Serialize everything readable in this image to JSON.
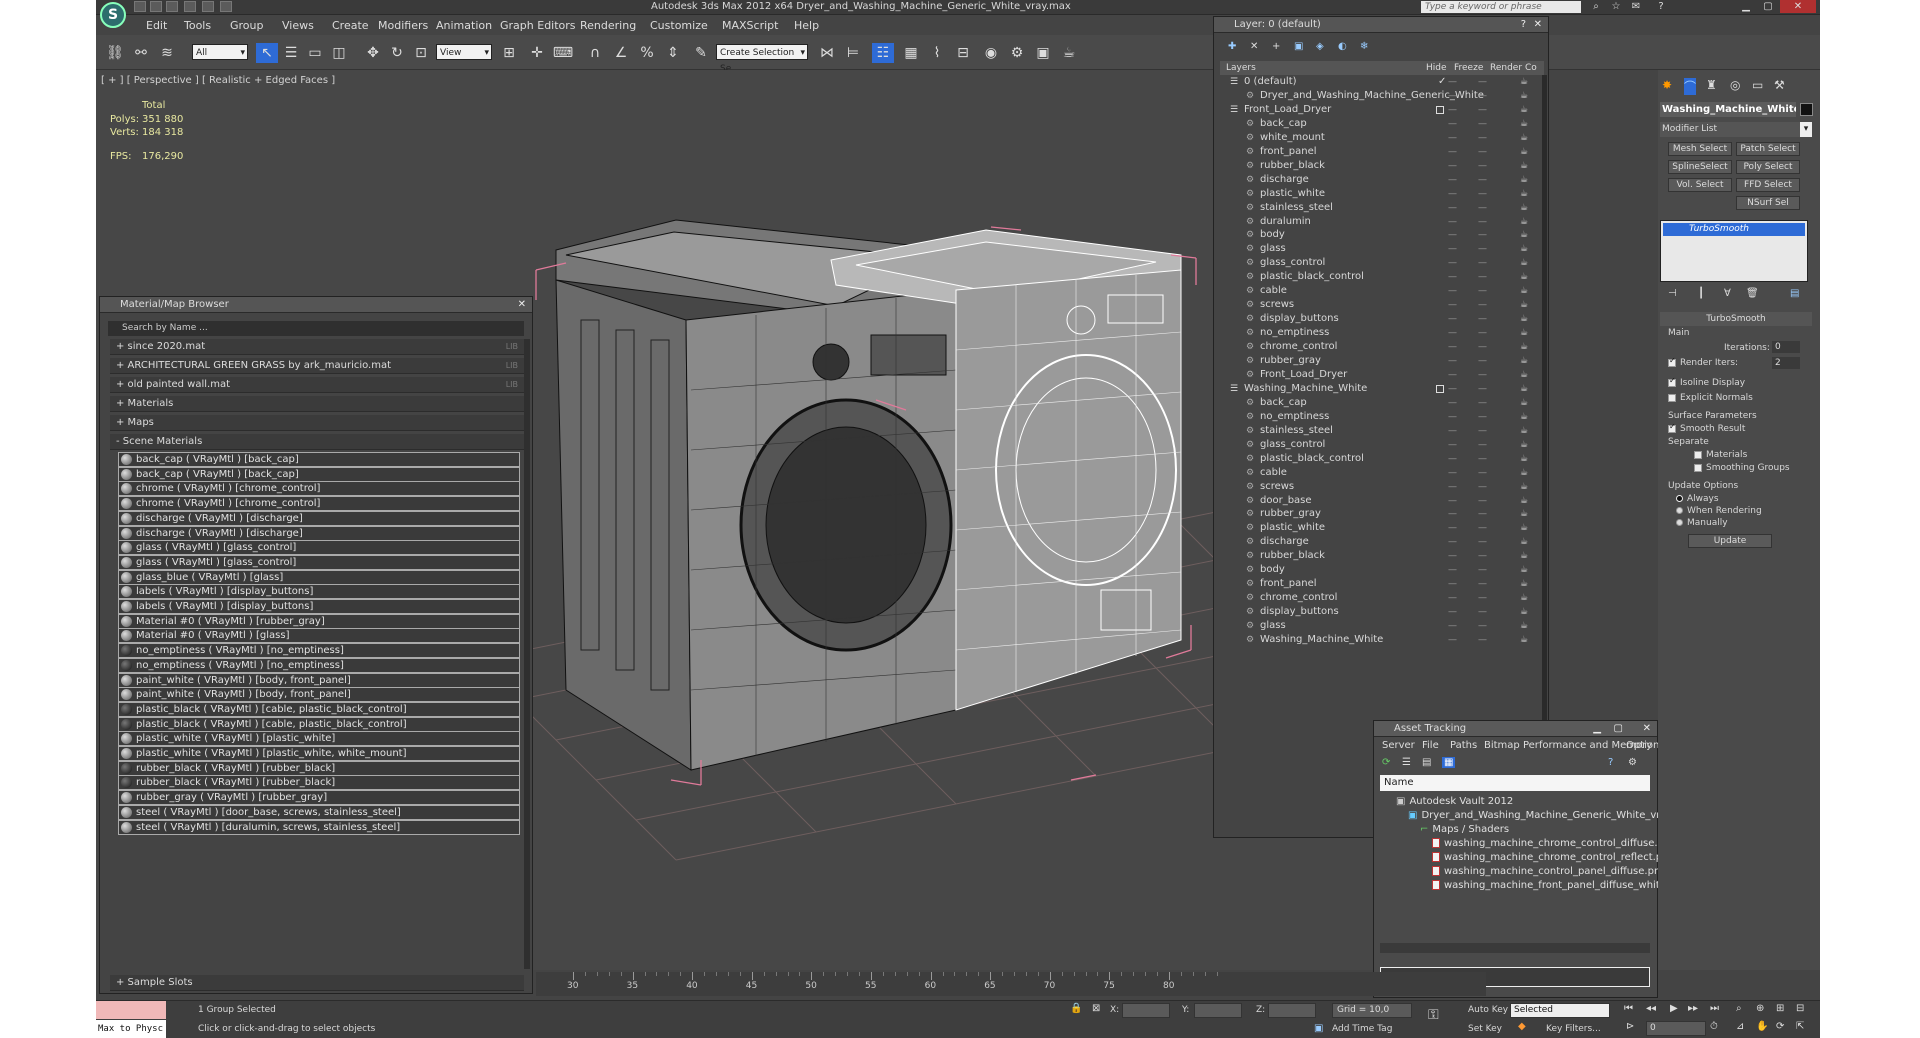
{
  "title": "Autodesk 3ds Max  2012 x64     Dryer_and_Washing_Machine_Generic_White_vray.max",
  "search_placeholder": "Type a keyword or phrase",
  "menu": [
    "Edit",
    "Tools",
    "Group",
    "Views",
    "Create",
    "Modifiers",
    "Animation",
    "Graph Editors",
    "Rendering",
    "Customize",
    "MAXScript",
    "Help"
  ],
  "toolbar": {
    "selection_filter": "All",
    "ref_coord": "View",
    "named_selection": "Create Selection Se"
  },
  "viewport": {
    "label": "[ + ] [ Perspective ] [ Realistic + Edged Faces ]",
    "stats_header": "Total",
    "polys_label": "Polys:",
    "polys_value": "351 880",
    "verts_label": "Verts:",
    "verts_value": "184 318",
    "fps_label": "FPS:",
    "fps_value": "176,290"
  },
  "material_browser": {
    "title": "Material/Map Browser",
    "search_placeholder": "Search by Name ...",
    "groups": [
      {
        "label": "+ since 2020.mat",
        "lib": "LIB"
      },
      {
        "label": "+ ARCHITECTURAL GREEN GRASS by ark_mauricio.mat",
        "lib": "LIB"
      },
      {
        "label": "+ old painted wall.mat",
        "lib": "LIB"
      },
      {
        "label": "+ Materials",
        "lib": ""
      },
      {
        "label": "+ Maps",
        "lib": ""
      },
      {
        "label": "- Scene Materials",
        "lib": ""
      }
    ],
    "materials": [
      "back_cap  ( VRayMtl ) [back_cap]",
      "back_cap  ( VRayMtl ) [back_cap]",
      "chrome  ( VRayMtl ) [chrome_control]",
      "chrome  ( VRayMtl ) [chrome_control]",
      "discharge  ( VRayMtl ) [discharge]",
      "discharge  ( VRayMtl ) [discharge]",
      "glass  ( VRayMtl ) [glass_control]",
      "glass  ( VRayMtl ) [glass_control]",
      "glass_blue  ( VRayMtl ) [glass]",
      "labels  ( VRayMtl ) [display_buttons]",
      "labels  ( VRayMtl ) [display_buttons]",
      "Material #0  ( VRayMtl ) [rubber_gray]",
      "Material #0  ( VRayMtl ) [glass]",
      "no_emptiness  ( VRayMtl ) [no_emptiness]",
      "no_emptiness  ( VRayMtl ) [no_emptiness]",
      "paint_white  ( VRayMtl ) [body, front_panel]",
      "paint_white  ( VRayMtl ) [body, front_panel]",
      "plastic_black  ( VRayMtl ) [cable, plastic_black_control]",
      "plastic_black  ( VRayMtl ) [cable, plastic_black_control]",
      "plastic_white  ( VRayMtl ) [plastic_white]",
      "plastic_white  ( VRayMtl ) [plastic_white, white_mount]",
      "rubber_black  ( VRayMtl ) [rubber_black]",
      "rubber_black  ( VRayMtl ) [rubber_black]",
      "rubber_gray  ( VRayMtl ) [rubber_gray]",
      "steel  ( VRayMtl ) [door_base, screws, stainless_steel]",
      "steel  ( VRayMtl ) [duralumin, screws, stainless_steel]"
    ],
    "sample_slots": "+ Sample Slots"
  },
  "layer_manager": {
    "title": "Layer: 0 (default)",
    "columns": [
      "Layers",
      "Hide",
      "Freeze",
      "Render",
      "Co"
    ],
    "rows": [
      {
        "name": "0 (default)",
        "level": 0,
        "flag": "check"
      },
      {
        "name": "Dryer_and_Washing_Machine_Generic_White",
        "level": 1,
        "flag": ""
      },
      {
        "name": "Front_Load_Dryer",
        "level": 0,
        "flag": "box"
      },
      {
        "name": "back_cap",
        "level": 1,
        "flag": ""
      },
      {
        "name": "white_mount",
        "level": 1,
        "flag": ""
      },
      {
        "name": "front_panel",
        "level": 1,
        "flag": ""
      },
      {
        "name": "rubber_black",
        "level": 1,
        "flag": ""
      },
      {
        "name": "discharge",
        "level": 1,
        "flag": ""
      },
      {
        "name": "plastic_white",
        "level": 1,
        "flag": ""
      },
      {
        "name": "stainless_steel",
        "level": 1,
        "flag": ""
      },
      {
        "name": "duralumin",
        "level": 1,
        "flag": ""
      },
      {
        "name": "body",
        "level": 1,
        "flag": ""
      },
      {
        "name": "glass",
        "level": 1,
        "flag": ""
      },
      {
        "name": "glass_control",
        "level": 1,
        "flag": ""
      },
      {
        "name": "plastic_black_control",
        "level": 1,
        "flag": ""
      },
      {
        "name": "cable",
        "level": 1,
        "flag": ""
      },
      {
        "name": "screws",
        "level": 1,
        "flag": ""
      },
      {
        "name": "display_buttons",
        "level": 1,
        "flag": ""
      },
      {
        "name": "no_emptiness",
        "level": 1,
        "flag": ""
      },
      {
        "name": "chrome_control",
        "level": 1,
        "flag": ""
      },
      {
        "name": "rubber_gray",
        "level": 1,
        "flag": ""
      },
      {
        "name": "Front_Load_Dryer",
        "level": 1,
        "flag": ""
      },
      {
        "name": "Washing_Machine_White",
        "level": 0,
        "flag": "box"
      },
      {
        "name": "back_cap",
        "level": 1,
        "flag": ""
      },
      {
        "name": "no_emptiness",
        "level": 1,
        "flag": ""
      },
      {
        "name": "stainless_steel",
        "level": 1,
        "flag": ""
      },
      {
        "name": "glass_control",
        "level": 1,
        "flag": ""
      },
      {
        "name": "plastic_black_control",
        "level": 1,
        "flag": ""
      },
      {
        "name": "cable",
        "level": 1,
        "flag": ""
      },
      {
        "name": "screws",
        "level": 1,
        "flag": ""
      },
      {
        "name": "door_base",
        "level": 1,
        "flag": ""
      },
      {
        "name": "rubber_gray",
        "level": 1,
        "flag": ""
      },
      {
        "name": "plastic_white",
        "level": 1,
        "flag": ""
      },
      {
        "name": "discharge",
        "level": 1,
        "flag": ""
      },
      {
        "name": "rubber_black",
        "level": 1,
        "flag": ""
      },
      {
        "name": "body",
        "level": 1,
        "flag": ""
      },
      {
        "name": "front_panel",
        "level": 1,
        "flag": ""
      },
      {
        "name": "chrome_control",
        "level": 1,
        "flag": ""
      },
      {
        "name": "display_buttons",
        "level": 1,
        "flag": ""
      },
      {
        "name": "glass",
        "level": 1,
        "flag": ""
      },
      {
        "name": "Washing_Machine_White",
        "level": 1,
        "flag": ""
      }
    ]
  },
  "asset_tracking": {
    "title": "Asset Tracking",
    "menu": [
      "Server",
      "File",
      "Paths",
      "Bitmap Performance and Memory",
      "Options"
    ],
    "column": "Name",
    "rows": [
      {
        "name": "Autodesk Vault 2012",
        "level": 0,
        "type": "vault"
      },
      {
        "name": "Dryer_and_Washing_Machine_Generic_White_vray.max",
        "level": 1,
        "type": "max"
      },
      {
        "name": "Maps / Shaders",
        "level": 2,
        "type": "folder"
      },
      {
        "name": "washing_machine_chrome_control_diffuse.png",
        "level": 3,
        "type": "png"
      },
      {
        "name": "washing_machine_chrome_control_reflect.png",
        "level": 3,
        "type": "png"
      },
      {
        "name": "washing_machine_control_panel_diffuse.png",
        "level": 3,
        "type": "png"
      },
      {
        "name": "washing_machine_front_panel_diffuse_white.png",
        "level": 3,
        "type": "png"
      }
    ]
  },
  "command_panel": {
    "object_name": "Washing_Machine_White",
    "modifier_list": "Modifier List",
    "buttons": [
      "Mesh Select",
      "Patch Select",
      "SplineSelect",
      "Poly Select",
      "Vol. Select",
      "FFD Select",
      "NSurf Sel"
    ],
    "stack_item": "TurboSmooth",
    "rollout_title": "TurboSmooth",
    "main_label": "Main",
    "iterations_label": "Iterations:",
    "iterations_value": "0",
    "render_iters_label": "Render Iters:",
    "render_iters_value": "2",
    "isoline_label": "Isoline Display",
    "explicit_normals_label": "Explicit Normals",
    "surface_params_label": "Surface Parameters",
    "smooth_result_label": "Smooth Result",
    "separate_label": "Separate",
    "materials_label": "Materials",
    "smoothing_groups_label": "Smoothing Groups",
    "update_options_label": "Update Options",
    "always_label": "Always",
    "when_rendering_label": "When Rendering",
    "manually_label": "Manually",
    "update_button": "Update"
  },
  "timeline_ticks": [
    "30",
    "35",
    "40",
    "45",
    "50",
    "55",
    "60",
    "65",
    "70",
    "75",
    "80"
  ],
  "status": {
    "script_listener": "Max to Physc",
    "selection": "1 Group Selected",
    "prompt": "Click or click-and-drag to select objects",
    "x_label": "X:",
    "y_label": "Y:",
    "z_label": "Z:",
    "grid": "Grid = 10,0",
    "add_time_tag": "Add Time Tag",
    "auto_key": "Auto Key",
    "set_key": "Set Key",
    "key_mode": "Selected",
    "key_filters": "Key Filters...",
    "frame": "0"
  },
  "colors": {
    "background": "#444444",
    "selection_blue": "#2e6bd6",
    "grid_line": "#6a5a5a",
    "bbox_pink": "#e07a9a",
    "stats_yellow": "#e8e8a0"
  }
}
